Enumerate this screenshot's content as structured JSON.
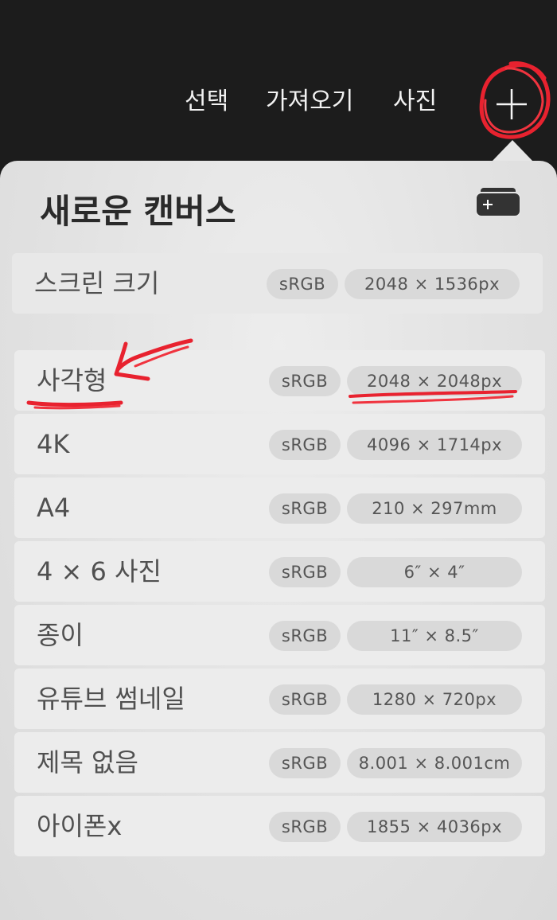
{
  "toolbar": {
    "select_label": "선택",
    "import_label": "가져오기",
    "photo_label": "사진"
  },
  "popover": {
    "title": "새로운 캔버스",
    "presets": [
      {
        "name": "스크린 크기",
        "color_profile": "sRGB",
        "size": "2048 × 1536px"
      },
      {
        "name": "사각형",
        "color_profile": "sRGB",
        "size": "2048 × 2048px"
      },
      {
        "name": "4K",
        "color_profile": "sRGB",
        "size": "4096 × 1714px"
      },
      {
        "name": "A4",
        "color_profile": "sRGB",
        "size": "210 × 297mm"
      },
      {
        "name": "4 × 6 사진",
        "color_profile": "sRGB",
        "size": "6″ × 4″"
      },
      {
        "name": "종이",
        "color_profile": "sRGB",
        "size": "11″ × 8.5″"
      },
      {
        "name": "유튜브 썸네일",
        "color_profile": "sRGB",
        "size": "1280 × 720px"
      },
      {
        "name": "제목 없음",
        "color_profile": "sRGB",
        "size": "8.001 × 8.001cm"
      },
      {
        "name": "아이폰x",
        "color_profile": "sRGB",
        "size": "1855 × 4036px"
      }
    ]
  },
  "colors": {
    "annotation": "#e8222f",
    "background_dark": "#1c1c1c"
  }
}
